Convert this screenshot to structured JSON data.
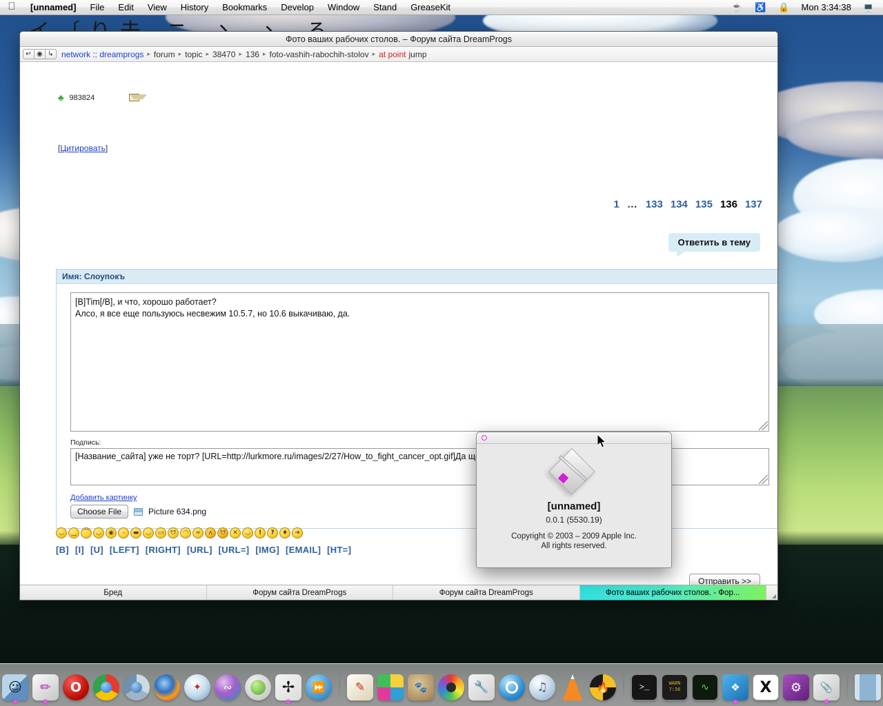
{
  "menubar": {
    "apple_icon": "apple-icon",
    "app_name": "[unnamed]",
    "items": [
      "File",
      "Edit",
      "View",
      "History",
      "Bookmarks",
      "Develop",
      "Window",
      "Stand",
      "GreaseKit"
    ],
    "status_icons": [
      "coffee-pot-icon",
      "headphones-icon",
      "lock-icon"
    ],
    "clock": "Mon 3:34:38",
    "display_icon": "display-icon"
  },
  "browser": {
    "title": "Фото ваших рабочих столов. – Форум сайта DreamProgs",
    "nav": {
      "back_icon": "back-arrow-icon",
      "reload_icon": "reload-icon",
      "forward_icon": "forward-arrow-icon"
    },
    "breadcrumb": [
      {
        "label": "network :: dreamprogs",
        "style": "link"
      },
      {
        "label": "forum",
        "style": "plain"
      },
      {
        "label": "topic",
        "style": "plain"
      },
      {
        "label": "38470",
        "style": "plain"
      },
      {
        "label": "136",
        "style": "plain"
      },
      {
        "label": "foto-vashih-rabochih-stolov",
        "style": "plain"
      },
      {
        "label": "at point",
        "style": "red"
      },
      {
        "label": "jump",
        "style": "plain"
      }
    ],
    "separator": "▸"
  },
  "post": {
    "rating_icon": "clover-icon",
    "rating_value": "983824",
    "mail_icon": "envelope-icon",
    "quote_label": "Цитировать",
    "quote_bracket_open": "[",
    "quote_bracket_close": "]"
  },
  "pagination": {
    "pages": [
      "1",
      "…",
      "133",
      "134",
      "135",
      "136",
      "137"
    ],
    "current": "136"
  },
  "reply": {
    "button_label": "Ответить в тему"
  },
  "form": {
    "header": "Имя: Слоупокъ",
    "message": "[B]Tim[/B], и что, хорошо работает?\nАлсо, я все еще пользуюсь несвежим 10.5.7, но 10.6 выкачиваю, да.",
    "signature_label": "Подпись:",
    "signature": "[Название_сайта] уже не торт? [URL=http://lurkmore.ru/images/2/27/How_to_fight_cancer_opt.gif]Да що вы говорите![/URL]",
    "add_picture_link": "Добавить картинку",
    "choose_file_label": "Choose File",
    "file_name": "Picture 634.png",
    "file_icon": "image-file-icon",
    "submit_label": "Отправить >>"
  },
  "emoticons": [
    {
      "name": "smiley-grin",
      "glyph": "◡"
    },
    {
      "name": "smiley-happy",
      "glyph": "‿"
    },
    {
      "name": "smiley-sad",
      "glyph": "⌒"
    },
    {
      "name": "smiley-silly",
      "glyph": "◡"
    },
    {
      "name": "smiley-crazy",
      "glyph": "◉"
    },
    {
      "name": "smiley-neutral",
      "glyph": "–"
    },
    {
      "name": "smiley-cool",
      "glyph": "▬"
    },
    {
      "name": "smiley-laugh",
      "glyph": "◡"
    },
    {
      "name": "smiley-teeth",
      "glyph": "▭"
    },
    {
      "name": "smiley-tongue",
      "glyph": "ᗢ"
    },
    {
      "name": "smiley-blush",
      "glyph": "◠"
    },
    {
      "name": "smiley-sweat",
      "glyph": "≈"
    },
    {
      "name": "smiley-devil-angry",
      "glyph": "ʌ"
    },
    {
      "name": "smiley-devil-grin",
      "glyph": "ᗢ"
    },
    {
      "name": "smiley-dizzy",
      "glyph": "✕"
    },
    {
      "name": "smiley-wink",
      "glyph": "◡"
    },
    {
      "name": "icon-exclamation",
      "glyph": "!"
    },
    {
      "name": "icon-question",
      "glyph": "?"
    },
    {
      "name": "icon-idea",
      "glyph": "♦"
    },
    {
      "name": "icon-arrow",
      "glyph": "➔"
    }
  ],
  "bbcodes": [
    "[B]",
    "[I]",
    "[U]",
    "[LEFT]",
    "[RIGHT]",
    "[URL]",
    "[URL=]",
    "[IMG]",
    "[EMAIL]",
    "[HT=]"
  ],
  "taskbar": {
    "tabs": [
      {
        "label": "Бред",
        "active": false
      },
      {
        "label": "Форум сайта DreamProgs",
        "active": false
      },
      {
        "label": "Форум сайта DreamProgs",
        "active": false
      },
      {
        "label": "Фото ваших рабочих столов. - Фор...",
        "active": true
      }
    ]
  },
  "about_dialog": {
    "close_icon": "close-dot-icon",
    "app_icon": "webkit-pencil-icon",
    "name": "[unnamed]",
    "version": "0.0.1 (5530.19)",
    "copyright_line1": "Copyright © 2003 – 2009 Apple Inc.",
    "copyright_line2": "All rights reserved."
  },
  "desktop": {
    "wallpaper_text": "イ〔り去 ニ ゝ ヽ ろ",
    "cursor_icon": "mouse-pointer-icon"
  },
  "dock": {
    "items": [
      {
        "name": "finder",
        "icon": "finder-icon",
        "color1": "#8fb6d9",
        "color2": "#5f8fbe",
        "shape": "square",
        "running": true
      },
      {
        "name": "webkit",
        "icon": "webkit-icon",
        "color1": "#e9e9e9",
        "color2": "#c6c6c6",
        "shape": "square",
        "running": true
      },
      {
        "name": "opera",
        "icon": "opera-icon",
        "color1": "#e8312a",
        "color2": "#a80d08",
        "shape": "circle",
        "running": false
      },
      {
        "name": "google-chrome",
        "icon": "chrome-icon",
        "color1": "#4fc14f",
        "color2": "#1a73e8",
        "shape": "circle",
        "running": false
      },
      {
        "name": "chromium",
        "icon": "chromium-icon",
        "color1": "#9fc2de",
        "color2": "#3b6ea5",
        "shape": "circle",
        "running": false
      },
      {
        "name": "firefox",
        "icon": "firefox-icon",
        "color1": "#f58a1f",
        "color2": "#1c4f9c",
        "shape": "circle",
        "running": false
      },
      {
        "name": "safari",
        "icon": "safari-compass-icon",
        "color1": "#dfeaf5",
        "color2": "#7ba7cf",
        "shape": "circle",
        "running": false
      },
      {
        "name": "shiira",
        "icon": "shiira-fish-icon",
        "color1": "#bb6fd0",
        "color2": "#2f8fc4",
        "shape": "circle",
        "running": false
      },
      {
        "name": "omniweb",
        "icon": "omniweb-icon",
        "color1": "#9fe06a",
        "color2": "#d9d9d9",
        "shape": "circle",
        "running": false
      },
      {
        "name": "camino",
        "icon": "camino-bird-icon",
        "color1": "#1a1a1a",
        "color2": "#2a2a2a",
        "shape": "square",
        "running": true
      },
      {
        "name": "fast-forward-app",
        "icon": "fast-forward-icon",
        "color1": "#4fb0ea",
        "color2": "#1464a8",
        "shape": "circle",
        "running": false
      },
      {
        "name": "separator-1",
        "icon": "separator",
        "shape": "sep"
      },
      {
        "name": "textedit",
        "icon": "textedit-pencil-icon",
        "color1": "#f7f2e6",
        "color2": "#d8cdb4",
        "shape": "square",
        "running": false
      },
      {
        "name": "color-app",
        "icon": "cmyk-diamond-icon",
        "color1": "#f5d23a",
        "color2": "#2f9fd4",
        "shape": "square",
        "running": false
      },
      {
        "name": "gimp",
        "icon": "gimp-wilber-icon",
        "color1": "#c8ab7e",
        "color2": "#8a6f49",
        "shape": "square",
        "running": false
      },
      {
        "name": "color-meter",
        "icon": "color-wheel-icon",
        "color1": "#e8e8e8",
        "color2": "#8a8a8a",
        "shape": "circle",
        "running": false
      },
      {
        "name": "utility-tools",
        "icon": "wrench-icon",
        "color1": "#e0e0e0",
        "color2": "#a8a8a8",
        "shape": "square",
        "running": false
      },
      {
        "name": "quicktime",
        "icon": "quicktime-icon",
        "color1": "#6fc4ee",
        "color2": "#1a6fb0",
        "shape": "circle",
        "running": false
      },
      {
        "name": "itunes",
        "icon": "itunes-note-icon",
        "color1": "#dfe8f0",
        "color2": "#9ab4cd",
        "shape": "circle",
        "running": false
      },
      {
        "name": "vlc",
        "icon": "vlc-cone-icon",
        "color1": "#f58a22",
        "color2": "#d4600c",
        "shape": "square",
        "running": false
      },
      {
        "name": "toast",
        "icon": "toast-burn-icon",
        "color1": "#2a2a2a",
        "color2": "#f5c021",
        "shape": "circle",
        "running": false
      },
      {
        "name": "separator-2",
        "icon": "separator",
        "shape": "sep"
      },
      {
        "name": "terminal",
        "icon": "terminal-icon",
        "color1": "#1a1a1a",
        "color2": "#2e2e2e",
        "shape": "square",
        "running": false
      },
      {
        "name": "console-warning",
        "icon": "console-warning-icon",
        "color1": "#2a2a2a",
        "color2": "#1a1a1a",
        "shape": "square",
        "running": false
      },
      {
        "name": "activity-monitor",
        "icon": "activity-monitor-icon",
        "color1": "#1a2a1a",
        "color2": "#0e1a0e",
        "shape": "square",
        "running": false
      },
      {
        "name": "dropbox",
        "icon": "dropbox-icon",
        "color1": "#3fa9e8",
        "color2": "#1a6fb0",
        "shape": "square",
        "running": true
      },
      {
        "name": "x11",
        "icon": "x11-icon",
        "color1": "#ffffff",
        "color2": "#e8e8e8",
        "shape": "square",
        "running": false
      },
      {
        "name": "system-preferences",
        "icon": "gear-pencil-icon",
        "color1": "#8a3f9e",
        "color2": "#5a1f6e",
        "shape": "square",
        "running": false
      },
      {
        "name": "archive-utility",
        "icon": "archive-clamp-icon",
        "color1": "#e8e8e8",
        "color2": "#b8b8b8",
        "shape": "square",
        "running": true
      },
      {
        "name": "separator-3",
        "icon": "separator",
        "shape": "sep"
      },
      {
        "name": "trash",
        "icon": "trash-icon",
        "color1": "#bfd8ea",
        "color2": "#7fa8c8",
        "shape": "square",
        "running": false
      }
    ]
  }
}
